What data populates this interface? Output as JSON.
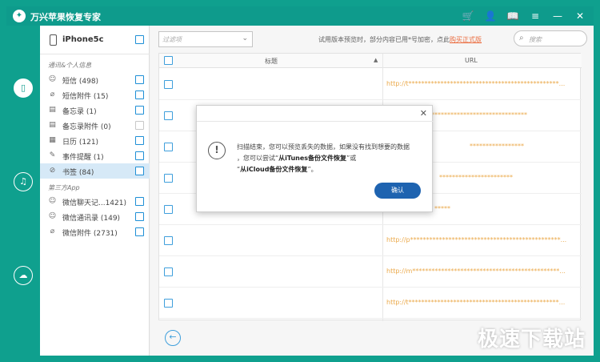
{
  "app": {
    "title": "万兴苹果恢复专家",
    "logo_glyph": "✦"
  },
  "titlebar_icons": [
    {
      "name": "cart-icon",
      "glyph": "🛒"
    },
    {
      "name": "user-icon",
      "glyph": "👤"
    },
    {
      "name": "book-icon",
      "glyph": "📖"
    },
    {
      "name": "menu-icon",
      "glyph": "≡"
    },
    {
      "name": "minimize-icon",
      "glyph": "—"
    },
    {
      "name": "close-icon",
      "glyph": "✕"
    }
  ],
  "rail": [
    {
      "name": "device-recovery-icon",
      "glyph": "▯",
      "active": true
    },
    {
      "name": "itunes-recovery-icon",
      "glyph": "♫",
      "active": false
    },
    {
      "name": "icloud-recovery-icon",
      "glyph": "☁",
      "active": false
    }
  ],
  "device": {
    "name": "iPhone5c"
  },
  "groups": {
    "personal": "通讯&个人信息",
    "third_party": "第三方App"
  },
  "categories": [
    {
      "label": "短信 (498)",
      "icon": "☺",
      "checked_dim": false
    },
    {
      "label": "短信附件 (15)",
      "icon": "⌀",
      "checked_dim": false
    },
    {
      "label": "备忘录 (1)",
      "icon": "▤",
      "checked_dim": false
    },
    {
      "label": "备忘录附件 (0)",
      "icon": "▤",
      "checked_dim": true
    },
    {
      "label": "日历 (121)",
      "icon": "▦",
      "checked_dim": false
    },
    {
      "label": "事件提醒 (1)",
      "icon": "✎",
      "checked_dim": false
    },
    {
      "label": "书签 (84)",
      "icon": "⊘",
      "checked_dim": false,
      "selected": true
    }
  ],
  "third_party": [
    {
      "label": "微信聊天记...1421)",
      "icon": "☺"
    },
    {
      "label": "微信通讯录 (149)",
      "icon": "☺"
    },
    {
      "label": "微信附件 (2731)",
      "icon": "⌀"
    }
  ],
  "toolbar": {
    "filter_placeholder": "过滤项",
    "trial_text": "试用版本预览时，部分内容已用*号加密，点此",
    "trial_link": "购买正式版",
    "search_placeholder": "搜索"
  },
  "table": {
    "col_title": "标题",
    "col_url": "URL",
    "rows": [
      {
        "url": "http://t***********************************************..."
      },
      {
        "url": "********************************************"
      },
      {
        "url": "*****************"
      },
      {
        "url": "***********************"
      },
      {
        "url": "*****"
      },
      {
        "url": "http://p***********************************************..."
      },
      {
        "url": "http://m**********************************************..."
      },
      {
        "url": "http://t***********************************************..."
      }
    ]
  },
  "dialog": {
    "line1": "扫描结束，您可以预览丢失的数据，如果没有找到想要的数据",
    "line2a": "，您可以尝试“",
    "line2b": "从iTunes备份文件恢复",
    "line2c": "”或",
    "line3a": "“",
    "line3b": "从iCloud备份文件恢复",
    "line3c": "”。",
    "ok_label": "确认"
  },
  "watermark": "极速下载站"
}
